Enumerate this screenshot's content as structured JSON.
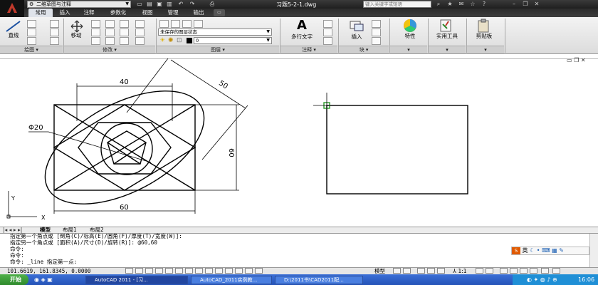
{
  "title_bar": {
    "workspace": "二维草图与注释",
    "document_title": "习题5-2-1.dwg",
    "search_placeholder": "键入关键字或短语"
  },
  "tabs": [
    {
      "label": "常用",
      "active": true
    },
    {
      "label": "插入",
      "active": false
    },
    {
      "label": "注释",
      "active": false
    },
    {
      "label": "参数化",
      "active": false
    },
    {
      "label": "视图",
      "active": false
    },
    {
      "label": "管理",
      "active": false
    },
    {
      "label": "输出",
      "active": false
    }
  ],
  "ribbon": {
    "draw": {
      "line_label": "直线",
      "panel_label": "绘图 ▾"
    },
    "modify": {
      "move_label": "移动",
      "panel_label": "修改 ▾"
    },
    "layers": {
      "layer_state": "未保存的图层状态",
      "current_layer": "0",
      "panel_label": "图层 ▾"
    },
    "annotation": {
      "mtext_label": "多行文字",
      "panel_label": "注释 ▾"
    },
    "block": {
      "insert_label": "插入",
      "panel_label": "块 ▾"
    },
    "properties": {
      "label": "特性"
    },
    "utilities": {
      "label": "实用工具"
    },
    "clipboard": {
      "label": "剪贴板"
    }
  },
  "drawing": {
    "dim_40": "40",
    "dim_50": "50",
    "dim_60_vertical": "60",
    "dim_60_horizontal": "60",
    "dim_diameter": "Φ20",
    "ucs_y": "Y",
    "ucs_x": "X"
  },
  "layout_tabs": [
    {
      "label": "模型",
      "active": true
    },
    {
      "label": "布局1",
      "active": false
    },
    {
      "label": "布局2",
      "active": false
    }
  ],
  "command_history": [
    "指定第一个角点或 [倒角(C)/标高(E)/圆角(F)/厚度(T)/宽度(W)]:",
    "指定另一个角点或 [面积(A)/尺寸(D)/旋转(R)]: @60,60",
    "命令:",
    "命令:",
    "命令: _line 指定第一点:"
  ],
  "status": {
    "coordinates": "101.6619, 161.8345, 0.0000",
    "model_label": "模型",
    "annotation_scale": "1:1"
  },
  "ime": {
    "label": "英"
  },
  "taskbar": {
    "start_label": "开始",
    "tasks": [
      {
        "label": "AutoCAD 2011 - [习...",
        "active": true
      },
      {
        "label": "AutoCAD_2011实例教...",
        "active": false
      },
      {
        "label": "D:\\2011书\\CAD2011配...",
        "active": false
      }
    ],
    "clock": "16:06"
  },
  "colors": {
    "titlebar": "#2a2a2a",
    "ribbon": "#e6e6e6",
    "taskbar": "#2b5dc6",
    "start": "#3c9a37",
    "cursor": "#2a9a2a"
  }
}
